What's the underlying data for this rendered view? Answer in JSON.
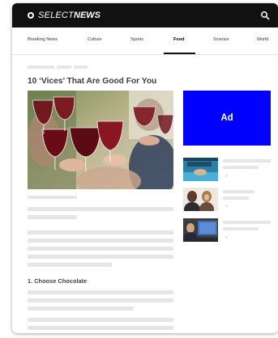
{
  "header": {
    "logo_select": "SELECT",
    "logo_news": "NEWS"
  },
  "nav": {
    "items": [
      "Breaking News",
      "Culture",
      "Sports",
      "Food",
      "Science",
      "World"
    ],
    "active_item": "Food"
  },
  "article": {
    "title": "10 ‘Vices’ That Are Good For You",
    "section_1_heading": "1. Choose Chocolate"
  },
  "ad": {
    "label": "Ad"
  },
  "colors": {
    "header_bg": "#111111",
    "ad_bg": "#0000ff",
    "placeholder_gray": "#e6e6e6"
  }
}
